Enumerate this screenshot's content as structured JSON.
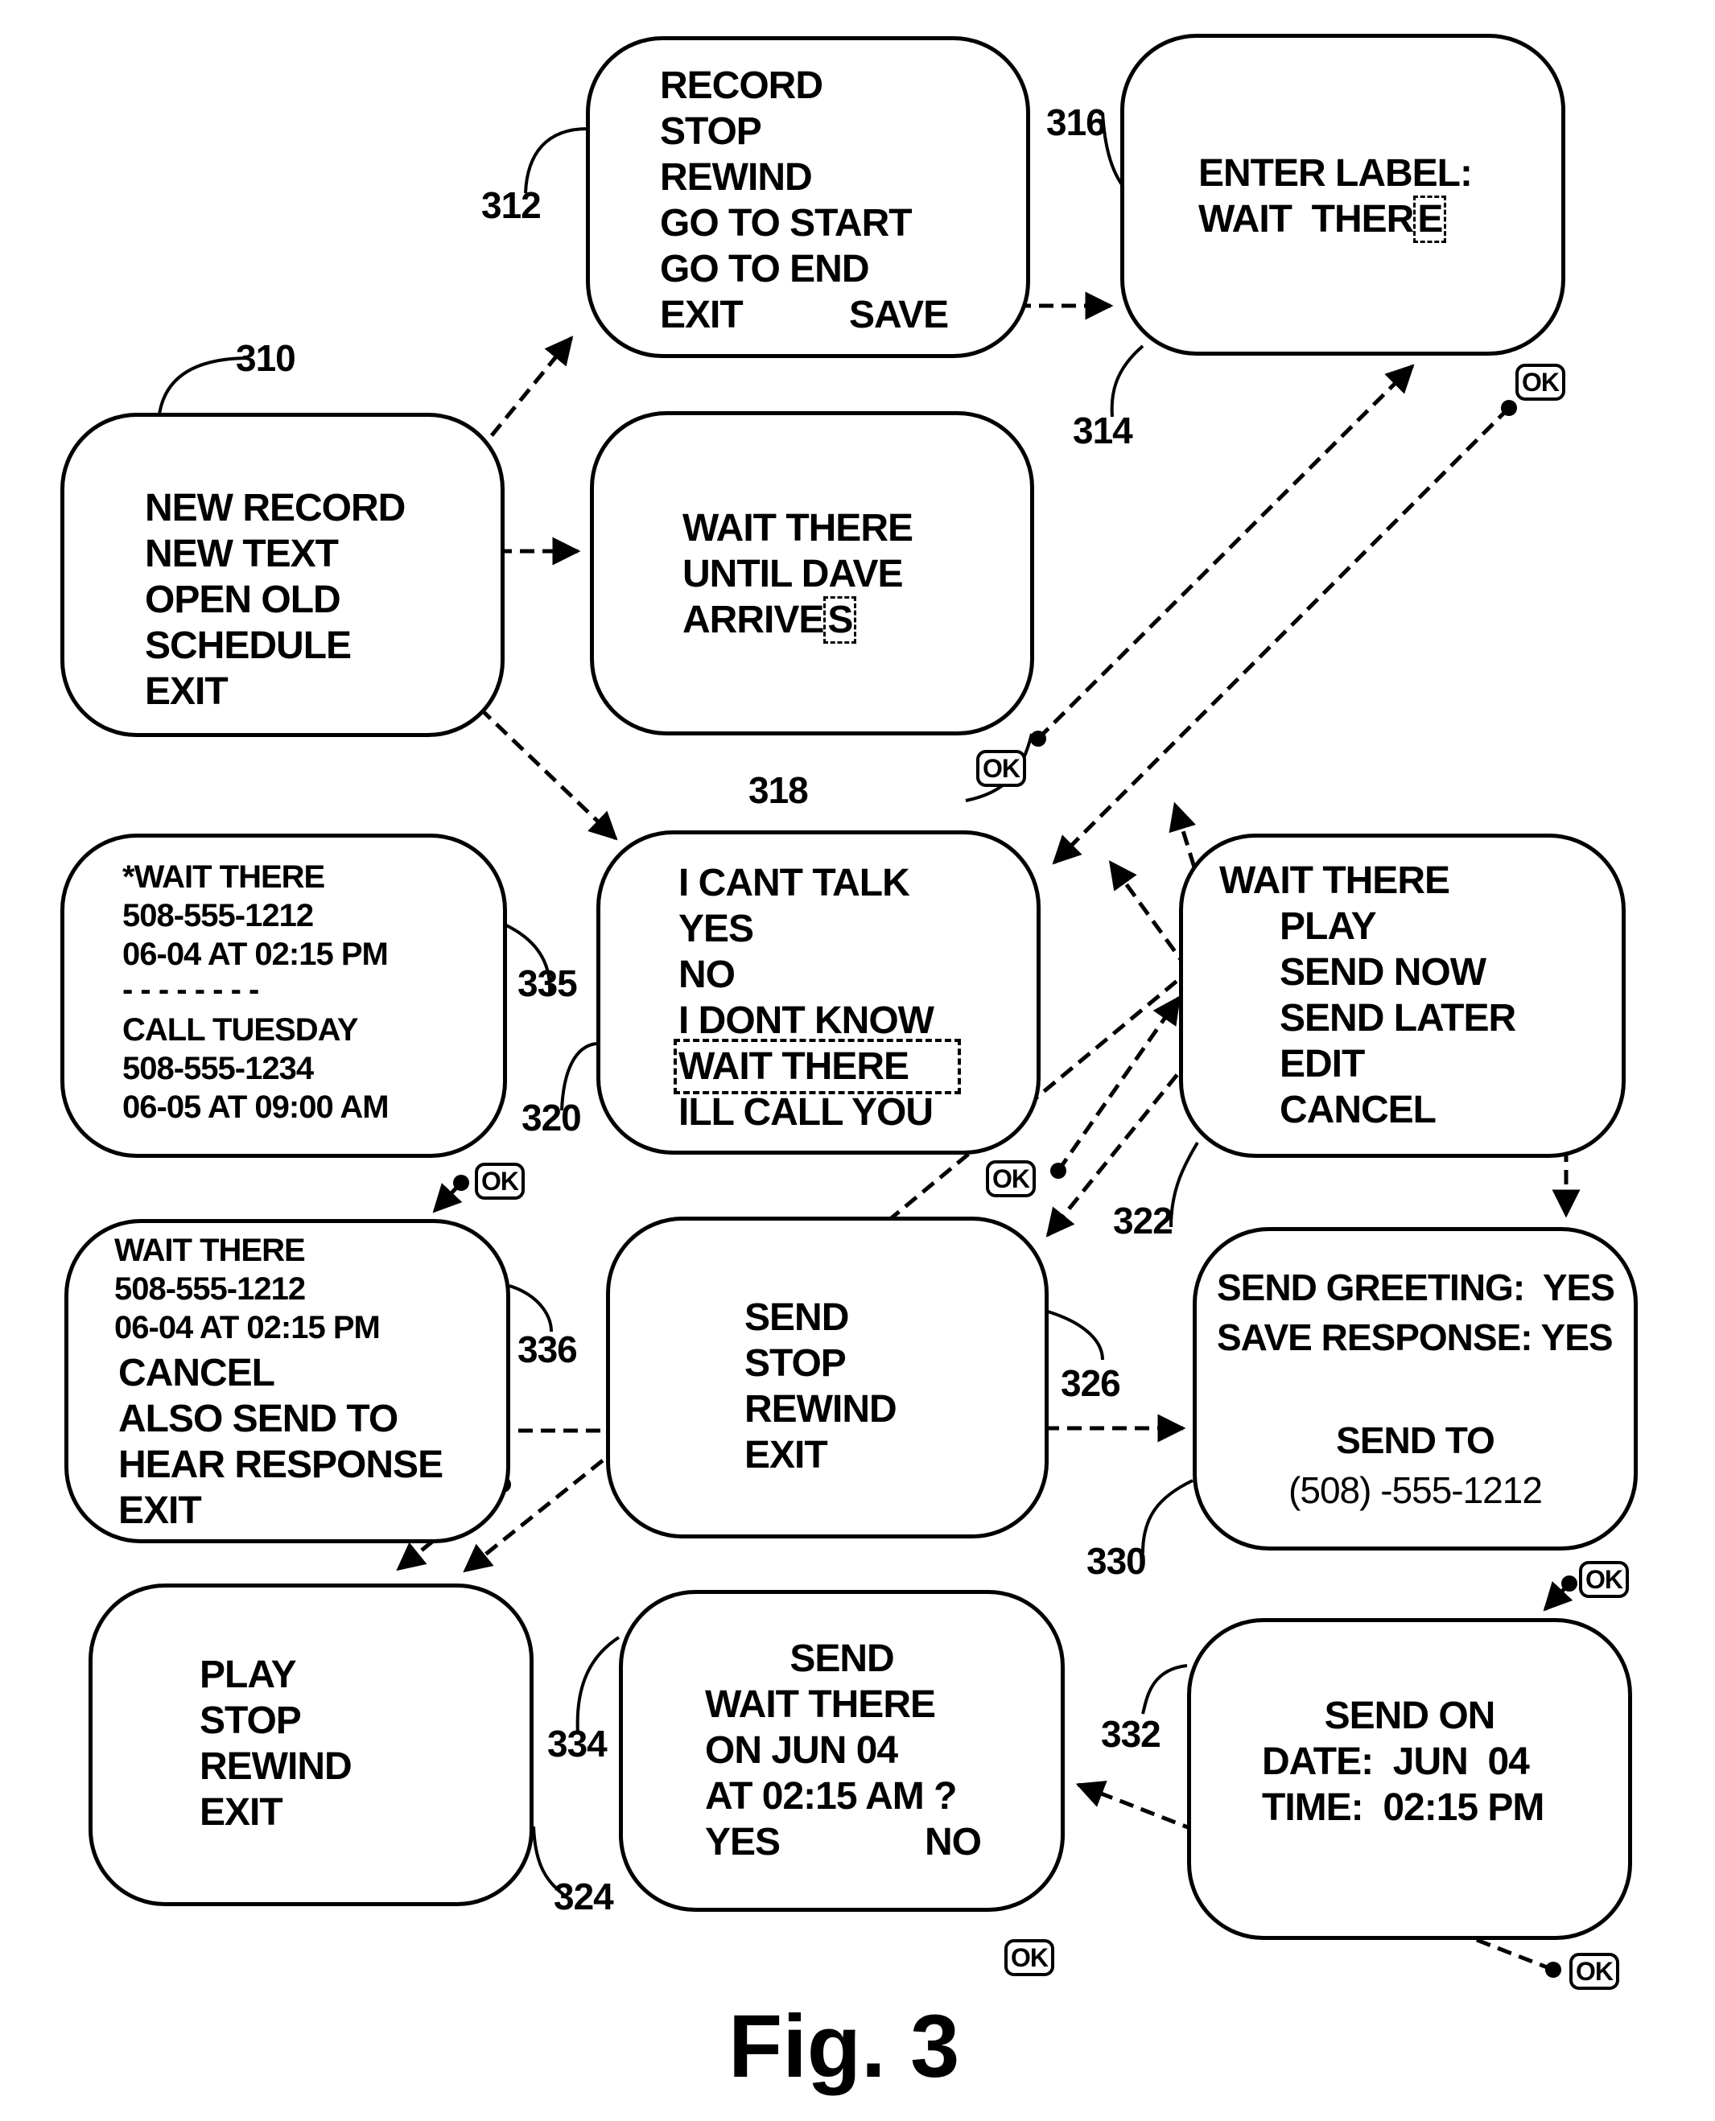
{
  "figure_label": "Fig. 3",
  "screens": {
    "s310": {
      "ref": "310",
      "items": [
        "NEW RECORD",
        "NEW TEXT",
        "OPEN OLD",
        "SCHEDULE",
        "EXIT"
      ]
    },
    "s312": {
      "ref": "312",
      "items": [
        "RECORD",
        "STOP",
        "REWIND",
        "GO TO START",
        "GO TO END",
        "EXIT"
      ],
      "save": "SAVE"
    },
    "s314": {
      "ref": "314",
      "ref_label": "316",
      "title": "ENTER LABEL:",
      "value": "WAIT  THER",
      "cursor_char": "E"
    },
    "s318": {
      "ref": "318",
      "lines": [
        "WAIT THERE",
        "UNTIL DAVE",
        "ARRIVE"
      ],
      "cursor_char": "S"
    },
    "s320": {
      "ref": "320",
      "items": [
        "I CANT TALK",
        "YES",
        "NO",
        "I DONT KNOW",
        "WAIT THERE",
        "ILL CALL YOU"
      ],
      "selected_index": 4
    },
    "s322": {
      "ref": "322",
      "title": "WAIT THERE",
      "items": [
        "PLAY",
        "SEND NOW",
        "SEND LATER",
        "EDIT",
        "CANCEL"
      ]
    },
    "s335": {
      "ref": "335",
      "lines": [
        "*WAIT THERE",
        "508-555-1212",
        "06-04 AT 02:15 PM",
        "- - - - - - - -",
        "CALL TUESDAY",
        "508-555-1234",
        "06-05 AT 09:00 AM"
      ]
    },
    "s336": {
      "ref": "336",
      "lines": [
        "WAIT THERE",
        "508-555-1212",
        "06-04 AT 02:15 PM"
      ],
      "items": [
        "CANCEL",
        "ALSO SEND TO",
        "HEAR RESPONSE",
        "EXIT"
      ]
    },
    "s326": {
      "ref": "326",
      "items": [
        "SEND",
        "STOP",
        "REWIND",
        "EXIT"
      ]
    },
    "s330": {
      "ref": "330",
      "lines": [
        "SEND GREETING:  YES",
        "SAVE RESPONSE: YES"
      ],
      "send_to_label": "SEND TO",
      "send_to_number": "(508) -555-1212"
    },
    "s324": {
      "ref": "324",
      "items": [
        "PLAY",
        "STOP",
        "REWIND",
        "EXIT"
      ]
    },
    "s334": {
      "ref": "334",
      "title": "SEND",
      "lines": [
        "WAIT THERE",
        "ON JUN 04",
        "AT 02:15 AM ?"
      ],
      "yes": "YES",
      "no": "NO"
    },
    "s332": {
      "ref": "332",
      "title": "SEND ON",
      "date": "DATE:  JUN  04",
      "time": "TIME:  02:15 PM"
    }
  },
  "ok_buttons": [
    "OK",
    "OK",
    "OK",
    "OK",
    "OK",
    "OK",
    "OK"
  ]
}
